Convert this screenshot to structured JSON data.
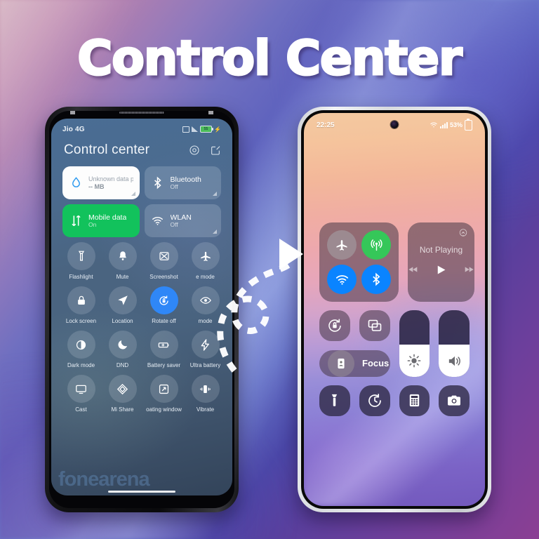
{
  "title": "Control Center",
  "colors": {
    "accent_blue": "#2f87f7",
    "green": "#12c25c",
    "ios_blue": "#0a84ff",
    "ios_green": "#35c759",
    "white": "#ffffff"
  },
  "left_phone": {
    "status_bar": {
      "carrier": "Jio 4G",
      "battery_text": "55",
      "icons": [
        "sim-icon",
        "signal-icon",
        "battery-icon",
        "charging-bolt-icon"
      ]
    },
    "header": {
      "title": "Control center",
      "actions": [
        {
          "name": "settings-gear-icon",
          "label": "Settings"
        },
        {
          "name": "edit-icon",
          "label": "Edit"
        }
      ]
    },
    "big_cards": [
      {
        "name": "data-plan-card",
        "title": "Unknown data plan",
        "sub": "-- MB",
        "icon": "water-drop-icon",
        "state": "light"
      },
      {
        "name": "bluetooth-card",
        "title": "Bluetooth",
        "sub": "Off",
        "icon": "bluetooth-icon",
        "state": "glass"
      },
      {
        "name": "mobile-data-card",
        "title": "Mobile data",
        "sub": "On",
        "icon": "data-arrows-icon",
        "state": "green"
      },
      {
        "name": "wlan-card",
        "title": "WLAN",
        "sub": "Off",
        "icon": "wifi-icon",
        "state": "glass"
      }
    ],
    "toggles": [
      {
        "label": "Flashlight",
        "icon": "flashlight-icon",
        "active": false
      },
      {
        "label": "Mute",
        "icon": "bell-icon",
        "active": false
      },
      {
        "label": "Screenshot",
        "icon": "screenshot-icon",
        "active": false
      },
      {
        "label": "e mode",
        "icon": "airplane-icon",
        "active": false
      },
      {
        "label": "Lock screen",
        "icon": "lock-icon",
        "active": false
      },
      {
        "label": "Location",
        "icon": "location-arrow-icon",
        "active": false
      },
      {
        "label": "Rotate off",
        "icon": "rotate-lock-icon",
        "active": true
      },
      {
        "label": "mode",
        "icon": "eye-icon",
        "active": false
      },
      {
        "label": "Dark mode",
        "icon": "contrast-icon",
        "active": false
      },
      {
        "label": "DND",
        "icon": "moon-icon",
        "active": false
      },
      {
        "label": "Battery saver",
        "icon": "battery-plus-icon",
        "active": false
      },
      {
        "label": "Ultra battery",
        "icon": "lightning-bolt-icon",
        "active": false
      },
      {
        "label": "Cast",
        "icon": "monitor-icon",
        "active": false
      },
      {
        "label": "Mi Share",
        "icon": "mi-share-icon",
        "active": false
      },
      {
        "label": "oating window",
        "icon": "floating-window-icon",
        "active": false
      },
      {
        "label": "Vibrate",
        "icon": "vibrate-icon",
        "active": false
      }
    ],
    "last_row": [
      {
        "label": "",
        "icon": "hotspot-icon",
        "active": false
      },
      {
        "label": "",
        "icon": "sync-icon",
        "active": true
      }
    ],
    "watermark": "fonearena"
  },
  "right_phone": {
    "status_bar": {
      "time": "22:25",
      "battery_percent": "53%",
      "icons": [
        "wifi-icon",
        "signal-bars-icon",
        "battery-icon"
      ]
    },
    "connectivity": [
      {
        "name": "airplane-mode-button",
        "icon": "airplane-icon",
        "state": "off"
      },
      {
        "name": "cellular-data-button",
        "icon": "cellular-icon",
        "state": "on-green"
      },
      {
        "name": "wifi-button",
        "icon": "wifi-icon",
        "state": "on-blue"
      },
      {
        "name": "bluetooth-button",
        "icon": "bluetooth-icon",
        "state": "on-blue"
      }
    ],
    "media": {
      "title": "Not Playing",
      "controls": [
        "rewind-icon",
        "play-icon",
        "forward-icon"
      ],
      "airplay": "airplay-icon"
    },
    "tiles": [
      {
        "name": "rotation-lock-tile",
        "icon": "rotation-lock-icon"
      },
      {
        "name": "screen-mirroring-tile",
        "icon": "screen-mirroring-icon"
      }
    ],
    "focus": {
      "label": "Focus",
      "icon": "focus-person-icon"
    },
    "sliders": [
      {
        "name": "brightness-slider",
        "icon": "brightness-icon",
        "value": 48
      },
      {
        "name": "volume-slider",
        "icon": "volume-icon",
        "value": 48
      }
    ],
    "shortcuts": [
      {
        "name": "flashlight-shortcut",
        "icon": "flashlight-icon"
      },
      {
        "name": "timer-shortcut",
        "icon": "timer-icon"
      },
      {
        "name": "calculator-shortcut",
        "icon": "calculator-icon"
      },
      {
        "name": "camera-shortcut",
        "icon": "camera-icon"
      }
    ]
  },
  "arrow": {
    "name": "dashed-spiral-arrow",
    "direction": "right"
  }
}
